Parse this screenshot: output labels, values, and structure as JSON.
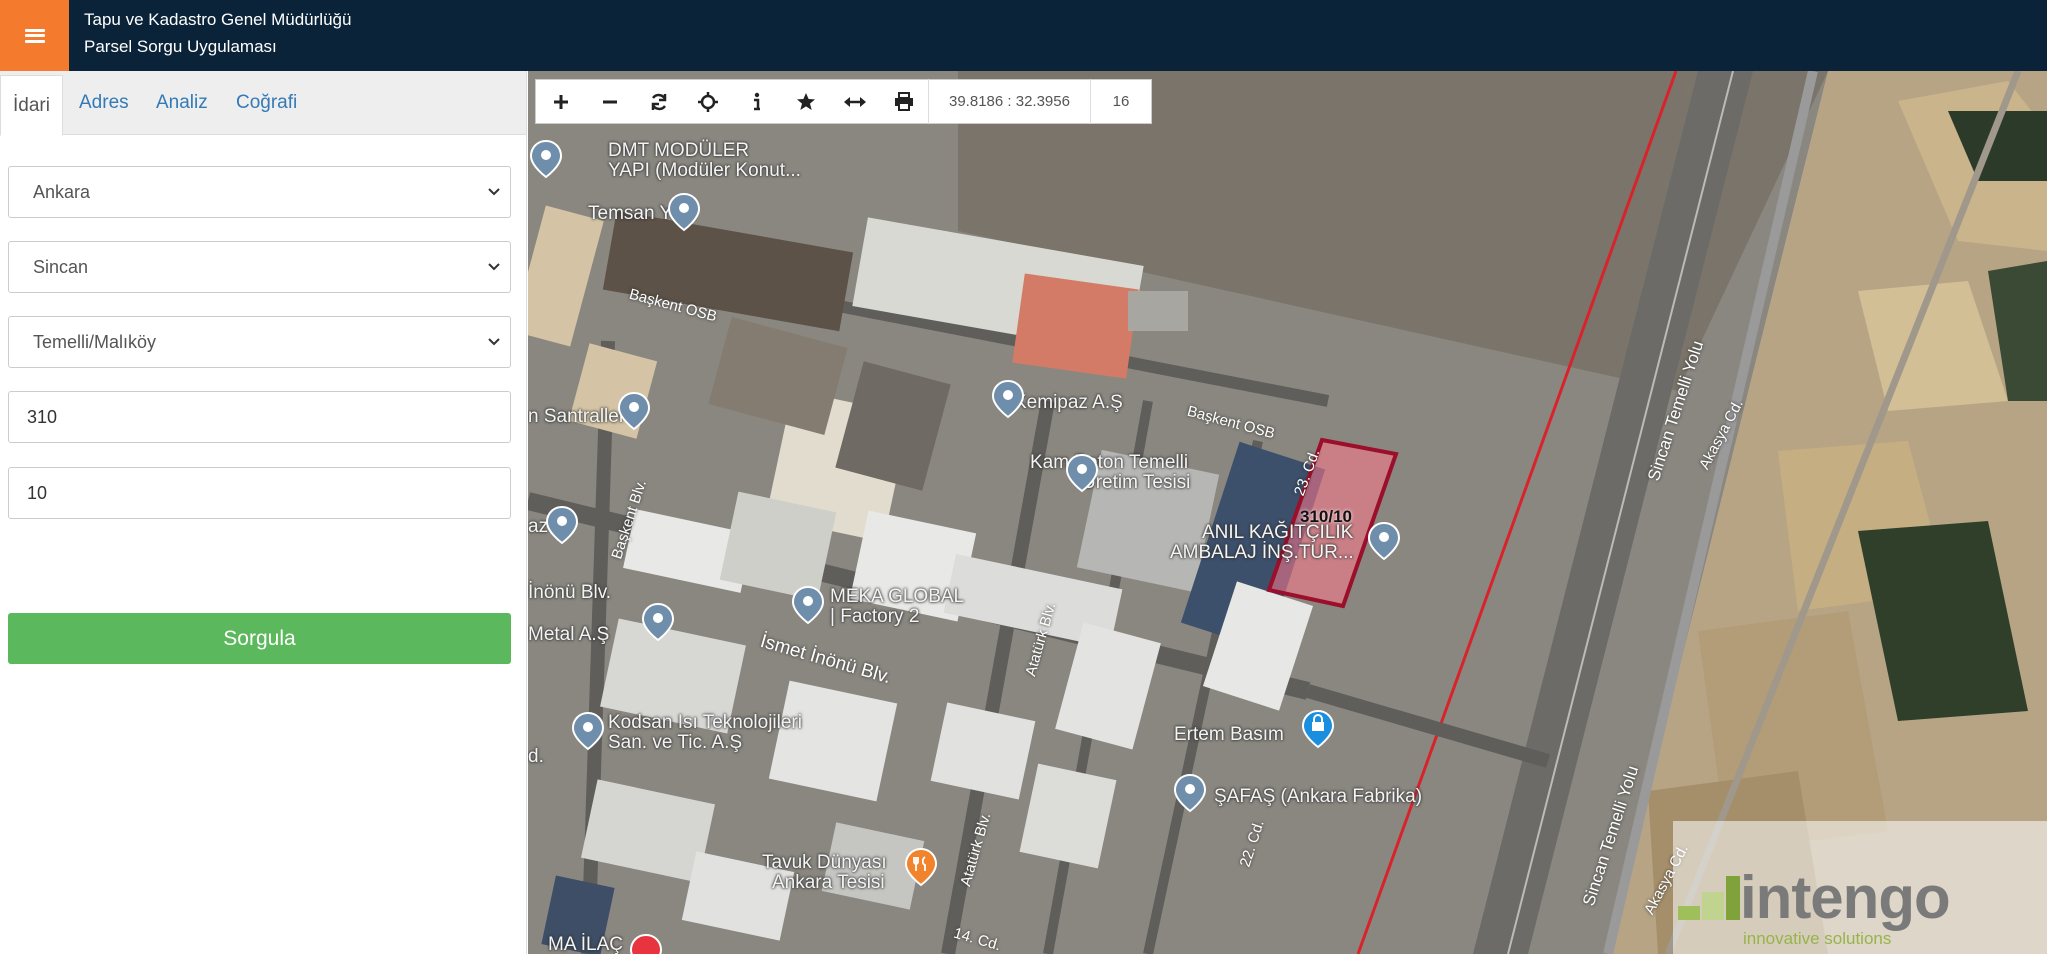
{
  "header": {
    "title_line1": "Tapu ve Kadastro Genel Müdürlüğü",
    "title_line2": "Parsel Sorgu Uygulaması",
    "menu_icon": "hamburger-icon",
    "accent_color": "#f47b2e",
    "bar_color": "#0a2338"
  },
  "sidebar": {
    "tabs": [
      {
        "label": "İdari",
        "active": true
      },
      {
        "label": "Adres",
        "active": false
      },
      {
        "label": "Analiz",
        "active": false
      },
      {
        "label": "Coğrafi",
        "active": false
      }
    ],
    "il_select": "Ankara",
    "ilce_select": "Sincan",
    "mahalle_select": "Temelli/Malıköy",
    "ada_input": "310",
    "parsel_input": "10",
    "submit_label": "Sorgula",
    "submit_color": "#5cb85c"
  },
  "map": {
    "toolbar_icons": [
      "zoom-in-icon",
      "zoom-out-icon",
      "refresh-icon",
      "locate-icon",
      "info-icon",
      "favorite-icon",
      "measure-icon",
      "print-icon"
    ],
    "coordinates": "39.8186 : 32.3956",
    "zoom_level": "16",
    "places": {
      "dmt_1": "DMT MODÜLER",
      "dmt_2": "YAPI (Modüler Konut...",
      "temsan": "Temsan Yapı",
      "santralleri": "n Santralleri",
      "kemipaz": "Kemipaz A.Ş",
      "kam_1": "Kam Beton Temelli",
      "kam_2": "Üretim Tesisi",
      "anil_1": "ANIL KAĞITÇILIK",
      "anil_2": "AMBALAJ İNŞ.TUR...",
      "az": "az",
      "meka_1": "MEKA GLOBAL",
      "meka_2": "| Factory 2",
      "metal": "Metal A.Ş",
      "inonu_left": "İnönü Blv.",
      "kodsan_1": "Kodsan Isı Teknolojileri",
      "kodsan_2": "San. ve Tic. A.Ş",
      "ertem": "Ertem Basım",
      "safas": "ŞAFAŞ (Ankara Fabrika)",
      "tavuk_1": "Tavuk Dünyası",
      "tavuk_2": "Ankara Tesisi",
      "d_left": "d.",
      "ma_ilac": "MA İLAÇ"
    },
    "roads": {
      "baskent_osb_1": "Başkent OSB",
      "baskent_osb_2": "Başkent OSB",
      "baskent_blv": "Başkent Blv.",
      "ismet_inonu": "İsmet İnönü Blv.",
      "ataturk_1": "Atatürk Blv.",
      "ataturk_2": "Atatürk Blv.",
      "cd23": "23. Cd.",
      "cd22": "22. Cd.",
      "cd14": "14. Cd.",
      "sincan_temelli_1": "Sincan Temelli Yolu",
      "sincan_temelli_2": "Sincan Temelli Yolu",
      "akasya_1": "Akasya Cd.",
      "akasya_2": "Akasya Cd."
    },
    "parcel_label": "310/10",
    "parcel_color": "#b0102a",
    "watermark": {
      "brand": "intengo",
      "tagline": "innovative solutions"
    }
  }
}
